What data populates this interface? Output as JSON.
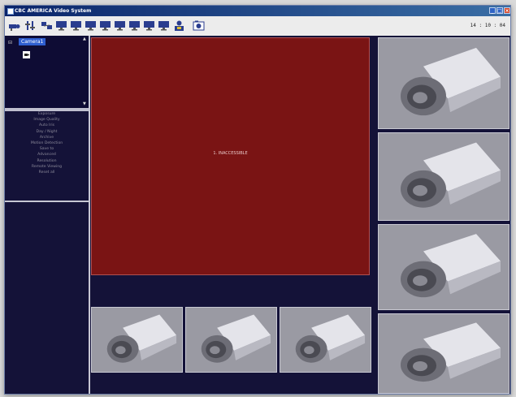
{
  "window": {
    "title": "CBC AMERICA Video System"
  },
  "toolbar": {
    "icons": [
      "camera-control-icon",
      "tools-icon",
      "network-icon",
      "monitor-icon",
      "monitor-icon",
      "monitor-icon",
      "monitor-icon",
      "monitor-icon",
      "monitor-icon",
      "monitor-icon",
      "user-icon",
      "snapshot-icon"
    ],
    "clock": "14 : 10 : 04"
  },
  "sidebar": {
    "tree": {
      "root_label": "Camera1"
    },
    "menu": [
      "Exposure",
      "Image Quality",
      "Auto Iris",
      "Day / Night",
      "Archive",
      "Motion Detection",
      "Save to",
      "Advanced",
      "Resolution",
      "Remote Viewing",
      "Reset all"
    ]
  },
  "main": {
    "big_view": {
      "label": "1. INACCESSIBLE",
      "color": "#7a1414"
    }
  },
  "colors": {
    "background": "#141238",
    "title_bar": "#0a246a",
    "panel_gray": "#9a9aa3"
  }
}
